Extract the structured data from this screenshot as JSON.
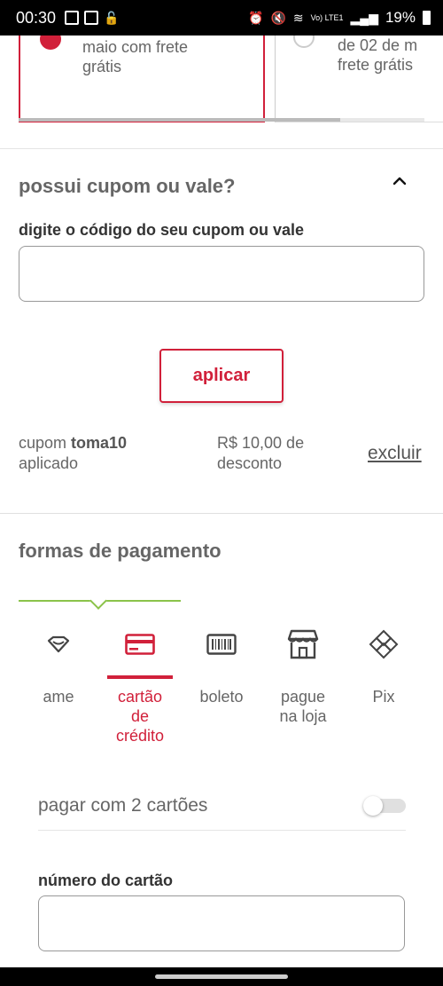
{
  "status_bar": {
    "time": "00:30",
    "network": "Vo) LTE1",
    "battery": "19%"
  },
  "offers": [
    {
      "text_line1": "maio com frete",
      "text_line2": "grátis",
      "selected": true
    },
    {
      "text_line1": "de 02 de m",
      "text_line2": "frete grátis",
      "selected": false
    }
  ],
  "coupon": {
    "title": "possui cupom ou vale?",
    "input_label": "digite o código do seu cupom ou vale",
    "input_value": "",
    "apply_label": "aplicar",
    "applied_prefix": "cupom ",
    "applied_code": "toma10",
    "applied_suffix": "aplicado",
    "discount_line1": "R$ 10,00 de",
    "discount_line2": "desconto",
    "remove_label": "excluir"
  },
  "payment": {
    "title": "formas de pagamento",
    "methods": [
      {
        "label": "ame",
        "icon": "ame-icon",
        "active": false
      },
      {
        "label": "cartão\nde\ncrédito",
        "icon": "credit-card-icon",
        "active": true
      },
      {
        "label": "boleto",
        "icon": "barcode-icon",
        "active": false
      },
      {
        "label": "pague\nna loja",
        "icon": "store-icon",
        "active": false
      },
      {
        "label": "Pix",
        "icon": "pix-icon",
        "active": false
      }
    ],
    "two_cards_label": "pagar com 2 cartões",
    "two_cards_enabled": false,
    "card_number_label": "número do cartão",
    "card_number_value": ""
  },
  "colors": {
    "accent": "#d1203a",
    "green": "#8bc34a",
    "text": "#666666"
  }
}
